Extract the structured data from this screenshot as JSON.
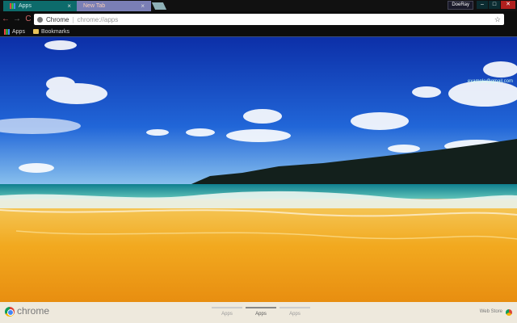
{
  "tabs": [
    {
      "label": "Apps",
      "active": true
    },
    {
      "label": "New Tab",
      "active": false
    }
  ],
  "window": {
    "profile_label": "DoeRay",
    "minimize": "–",
    "maximize": "□",
    "close": "✕"
  },
  "toolbar": {
    "back": "←",
    "forward": "→",
    "reload": "C",
    "omnibox_brand": "Chrome",
    "omnibox_url": "chrome://apps",
    "star": "☆"
  },
  "bookmarks": [
    {
      "label": "Apps",
      "icon": "apps-grid-icon"
    },
    {
      "label": "Bookmarks",
      "icon": "folder-icon"
    }
  ],
  "account_email": "example@gmail.com",
  "footer": {
    "brand": "chrome",
    "pages": [
      "Apps",
      "Apps",
      "Apps"
    ],
    "active_page_index": 1,
    "webstore_label": "Web Store"
  },
  "colors": {
    "active_tab": "#0d6b6b",
    "inactive_tab": "#7a7fb6",
    "close_button": "#b0201e",
    "footer_bg": "#eee9dd"
  }
}
